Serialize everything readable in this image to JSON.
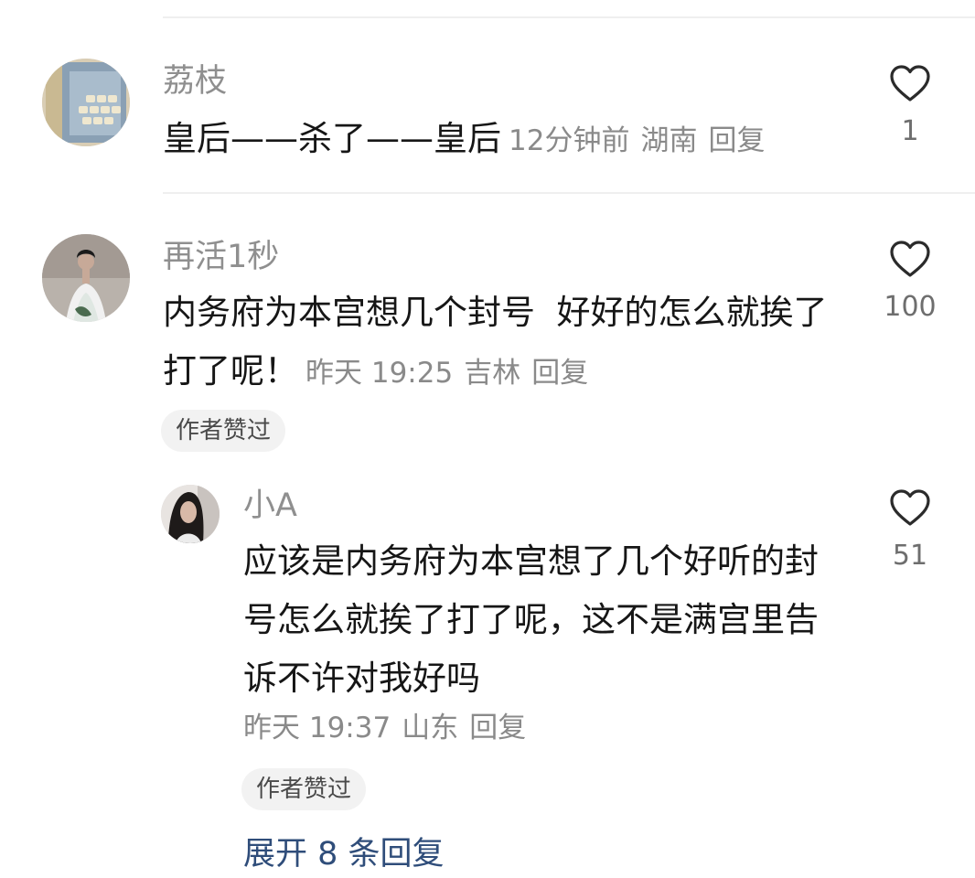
{
  "comments": [
    {
      "name": "荔枝",
      "text": "皇后——杀了——皇后",
      "time": "12分钟前",
      "location": "湖南",
      "reply_label": "回复",
      "likes": "1",
      "avatar_icon": "avatar-image"
    },
    {
      "name": "再活1秒",
      "text": "内务府为本宫想几个封号  好好的怎么就挨了打了呢！",
      "time": "昨天 19:25",
      "location": "吉林",
      "reply_label": "回复",
      "likes": "100",
      "badge": "作者赞过",
      "avatar_icon": "avatar-image"
    }
  ],
  "reply": {
    "name": "小A",
    "text": "应该是内务府为本宫想了几个好听的封号怎么就挨了打了呢，这不是满宫里告诉不许对我好吗",
    "time": "昨天 19:37",
    "location": "山东",
    "reply_label": "回复",
    "likes": "51",
    "badge": "作者赞过",
    "avatar_icon": "avatar-image"
  },
  "expand_label": "展开 8 条回复",
  "icons": {
    "like": "heart-outline-icon"
  },
  "colors": {
    "link": "#2f4d7a",
    "name": "#8f8f8f",
    "meta": "#8a8a8a"
  }
}
